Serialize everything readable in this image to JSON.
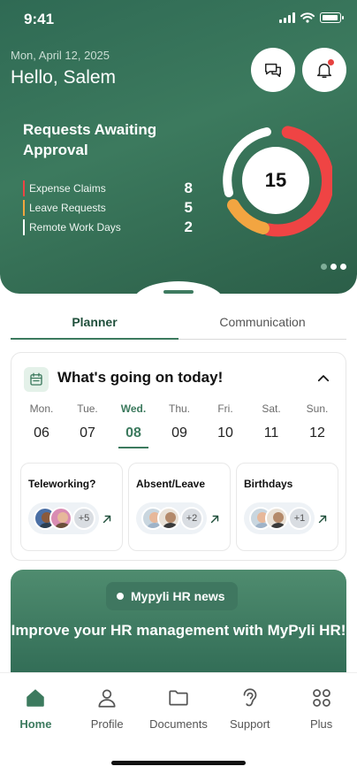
{
  "status_bar": {
    "time": "9:41"
  },
  "header": {
    "date": "Mon, April 12, 2025",
    "greeting": "Hello, Salem",
    "requests_title": "Requests Awaiting Approval",
    "requests": [
      {
        "label": "Expense Claims",
        "value": "8",
        "color": "#ef4444"
      },
      {
        "label": "Leave Requests",
        "value": "5",
        "color": "#f2a541"
      },
      {
        "label": "Remote Work Days",
        "value": "2",
        "color": "#ffffff"
      }
    ],
    "total": "15",
    "carousel": {
      "pages": 3,
      "current": 1
    }
  },
  "tabs": [
    {
      "label": "Planner",
      "active": true
    },
    {
      "label": "Communication",
      "active": false
    }
  ],
  "today": {
    "title": "What's going on today!",
    "days": [
      {
        "name": "Mon.",
        "date": "06"
      },
      {
        "name": "Tue.",
        "date": "07"
      },
      {
        "name": "Wed.",
        "date": "08",
        "active": true
      },
      {
        "name": "Thu.",
        "date": "09"
      },
      {
        "name": "Fri.",
        "date": "10"
      },
      {
        "name": "Sat.",
        "date": "11"
      },
      {
        "name": "Sun.",
        "date": "12"
      }
    ],
    "cards": [
      {
        "title": "Teleworking?",
        "more": "+5"
      },
      {
        "title": "Absent/Leave",
        "more": "+2"
      },
      {
        "title": "Birthdays",
        "more": "+1"
      }
    ]
  },
  "news": {
    "badge": "Mypyli HR news",
    "headline": "Improve your HR management with MyPyli HR!"
  },
  "nav": [
    {
      "label": "Home",
      "icon": "home-icon",
      "active": true
    },
    {
      "label": "Profile",
      "icon": "profile-icon"
    },
    {
      "label": "Documents",
      "icon": "folder-icon"
    },
    {
      "label": "Support",
      "icon": "support-icon"
    },
    {
      "label": "Plus",
      "icon": "grid-icon"
    }
  ],
  "colors": {
    "brand": "#3c7a5e",
    "accent_red": "#ef4444",
    "accent_orange": "#f2a541"
  }
}
